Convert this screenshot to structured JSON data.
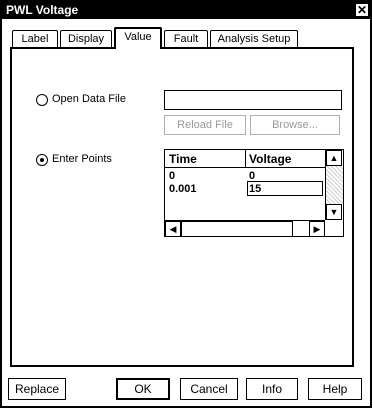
{
  "window": {
    "title": "PWL Voltage"
  },
  "tabs": [
    {
      "label": "Label"
    },
    {
      "label": "Display"
    },
    {
      "label": "Value"
    },
    {
      "label": "Fault"
    },
    {
      "label": "Analysis Setup"
    }
  ],
  "active_tab": "Value",
  "value_panel": {
    "open_data_file_label": "Open Data File",
    "file_path_value": "",
    "reload_file_label": "Reload File",
    "browse_label": "Browse...",
    "enter_points_label": "Enter Points",
    "selected_option": "Enter Points",
    "points_table": {
      "columns": [
        "Time",
        "Voltage"
      ],
      "rows": [
        {
          "time": "0",
          "voltage": "0"
        },
        {
          "time": "0.001",
          "voltage": "15"
        }
      ]
    }
  },
  "buttons": {
    "replace": "Replace",
    "ok": "OK",
    "cancel": "Cancel",
    "info": "Info",
    "help": "Help"
  },
  "icons": {
    "close": "close-icon",
    "scroll_up": "arrow-up-icon",
    "scroll_down": "arrow-down-icon",
    "scroll_left": "arrow-left-icon",
    "scroll_right": "arrow-right-icon"
  }
}
